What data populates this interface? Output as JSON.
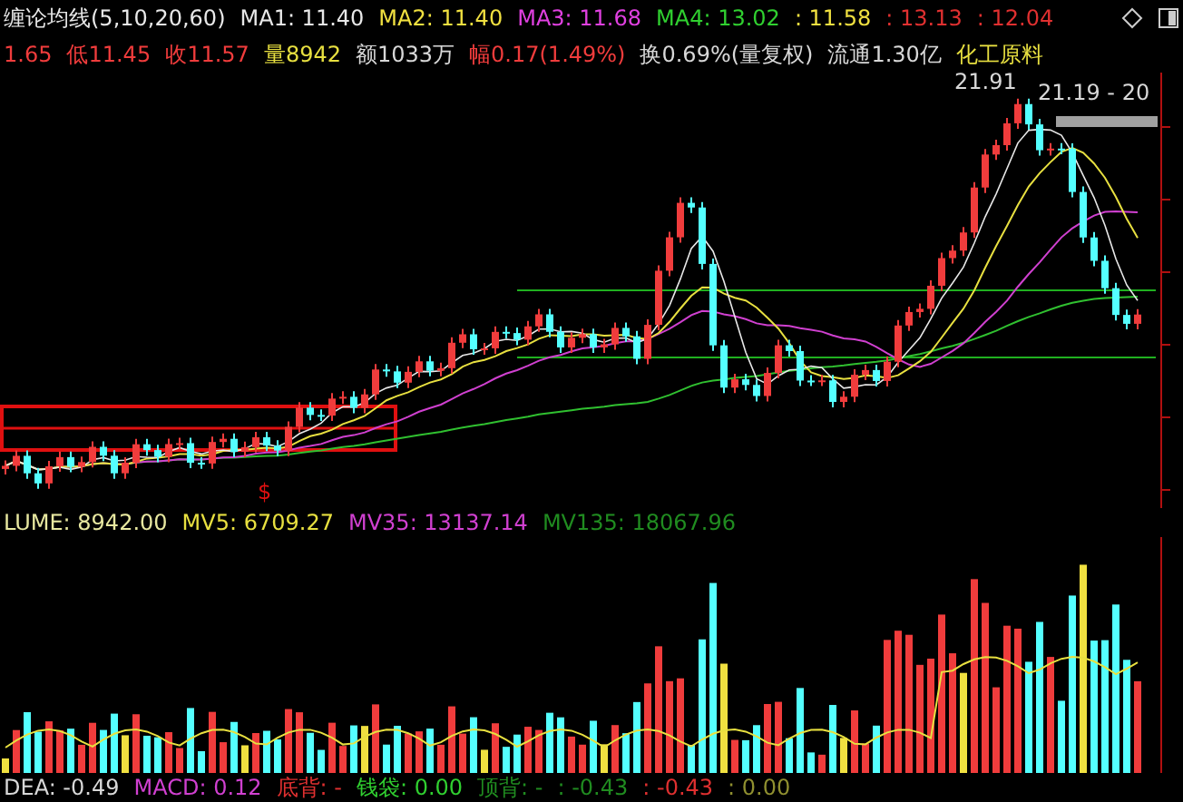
{
  "indicator_bar": {
    "title": "缠论均线(5,10,20,60)",
    "items": [
      {
        "text": "MA1: 11.40",
        "color": "#e8e8e8"
      },
      {
        "text": "MA2: 11.40",
        "color": "#f0e040"
      },
      {
        "text": "MA3: 11.68",
        "color": "#e040e0"
      },
      {
        "text": "MA4: 13.02",
        "color": "#30d030"
      },
      {
        "text": ": 11.58",
        "color": "#f0e040"
      },
      {
        "text": ": 13.13",
        "color": "#e03030"
      },
      {
        "text": ": 12.04",
        "color": "#e03030"
      }
    ]
  },
  "quote_bar": [
    {
      "text": "1.65",
      "color": "#f03c3c"
    },
    {
      "text": "低11.45",
      "color": "#f03c3c"
    },
    {
      "text": "收11.57",
      "color": "#f03c3c"
    },
    {
      "text": "量8942",
      "color": "#e8e040"
    },
    {
      "text": "额1033万",
      "color": "#d8d8d8"
    },
    {
      "text": "幅0.17(1.49%)",
      "color": "#f03c3c"
    },
    {
      "text": "换0.69%(量复权)",
      "color": "#d8d8d8"
    },
    {
      "text": "流通1.30亿",
      "color": "#d8d8d8"
    },
    {
      "text": "化工原料",
      "color": "#e8e040"
    }
  ],
  "price_chart": {
    "high_label": "21.91",
    "range_label": "21.19 - 20",
    "marker": "$"
  },
  "volume_bar": [
    {
      "text": "LUME: 8942.00",
      "color": "#e8e8a0"
    },
    {
      "text": "MV5: 6709.27",
      "color": "#e8e040"
    },
    {
      "text": "MV35: 13137.14",
      "color": "#d040d0"
    },
    {
      "text": "MV135: 18067.96",
      "color": "#208c20"
    }
  ],
  "macd_bar": [
    {
      "text": "DEA: -0.49",
      "color": "#d8d8d8"
    },
    {
      "text": "MACD: 0.12",
      "color": "#d040d0"
    },
    {
      "text": "底背: -",
      "color": "#e03030"
    },
    {
      "text": "钱袋: 0.00",
      "color": "#30d030"
    },
    {
      "text": "顶背: -",
      "color": "#208c20"
    },
    {
      "text": ": -0.43",
      "color": "#208c20"
    },
    {
      "text": ": -0.43",
      "color": "#e03030"
    },
    {
      "text": ": 0.00",
      "color": "#909030"
    }
  ]
}
